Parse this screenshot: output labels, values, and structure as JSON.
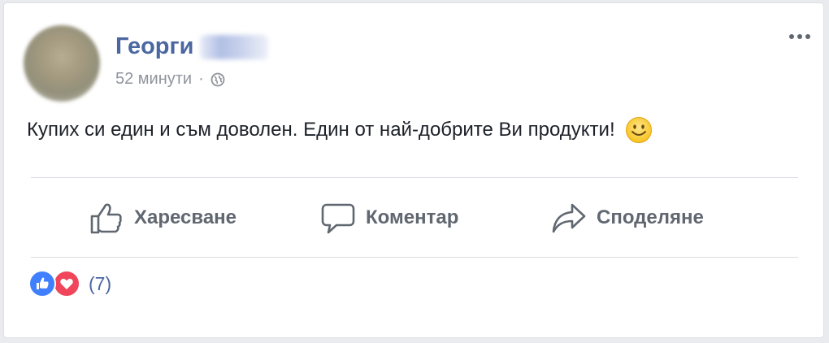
{
  "post": {
    "author_first_name": "Георги",
    "timestamp": "52 минути",
    "separator": "·",
    "privacy_icon": "globe-icon",
    "text": "Купих си един и съм доволен. Един от най-добрите Ви продукти!",
    "emoji": "smile-icon"
  },
  "actions": {
    "like_label": "Харесване",
    "comment_label": "Коментар",
    "share_label": "Споделяне"
  },
  "reactions": {
    "types": [
      "like",
      "love"
    ],
    "count_label": "(7)"
  },
  "colors": {
    "brand_blue": "#4b67a1",
    "like_blue": "#4080ff",
    "love_red": "#f0455b",
    "text_gray": "#606770"
  }
}
